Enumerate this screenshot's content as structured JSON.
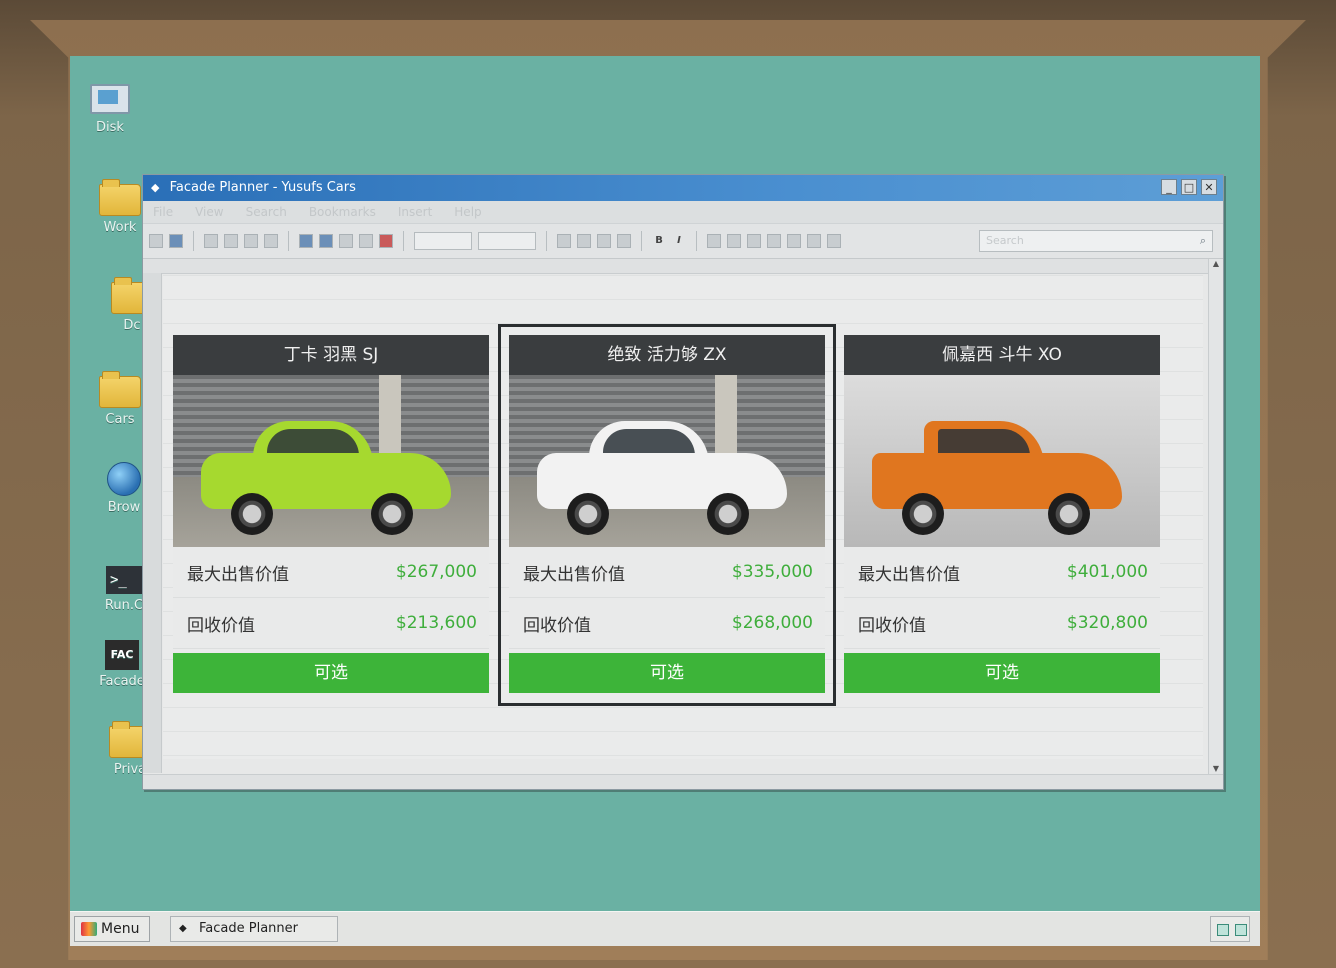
{
  "desktop": {
    "icons": [
      {
        "label": "Disk"
      },
      {
        "label": "Work"
      },
      {
        "label": "Dc"
      },
      {
        "label": "Cars"
      },
      {
        "label": "Brow"
      },
      {
        "label": "Run.C"
      },
      {
        "label": "Facade"
      },
      {
        "label": "Priva"
      }
    ],
    "facade_icon_text": "FAC"
  },
  "window": {
    "title": "Facade Planner - Yusufs Cars",
    "menu": [
      "File",
      "View",
      "Search",
      "Bookmarks",
      "Insert",
      "Help"
    ],
    "search_placeholder": "Search",
    "bold_label": "B",
    "italic_label": "I"
  },
  "cards": [
    {
      "name": "丁卡 羽黑 SJ",
      "max_sale_label": "最大出售价值",
      "max_sale_value": "$267,000",
      "buyback_label": "回收价值",
      "buyback_value": "$213,600",
      "button_label": "可选",
      "car_color": "#a6d92f"
    },
    {
      "name": "绝致 活力够 ZX",
      "max_sale_label": "最大出售价值",
      "max_sale_value": "$335,000",
      "buyback_label": "回收价值",
      "buyback_value": "$268,000",
      "button_label": "可选",
      "car_color": "#f2f2f2"
    },
    {
      "name": "佩嘉西 斗牛 XO",
      "max_sale_label": "最大出售价值",
      "max_sale_value": "$401,000",
      "buyback_label": "回收价值",
      "buyback_value": "$320,800",
      "button_label": "可选",
      "car_color": "#e0761f"
    }
  ],
  "taskbar": {
    "menu_label": "Menu",
    "task_label": "Facade Planner"
  },
  "colors": {
    "desktop": "#6ab1a3",
    "titlebar": "#2a6fb7",
    "price_green": "#3fae3c",
    "button_green": "#3db439",
    "card_header": "#3a3d3f"
  }
}
